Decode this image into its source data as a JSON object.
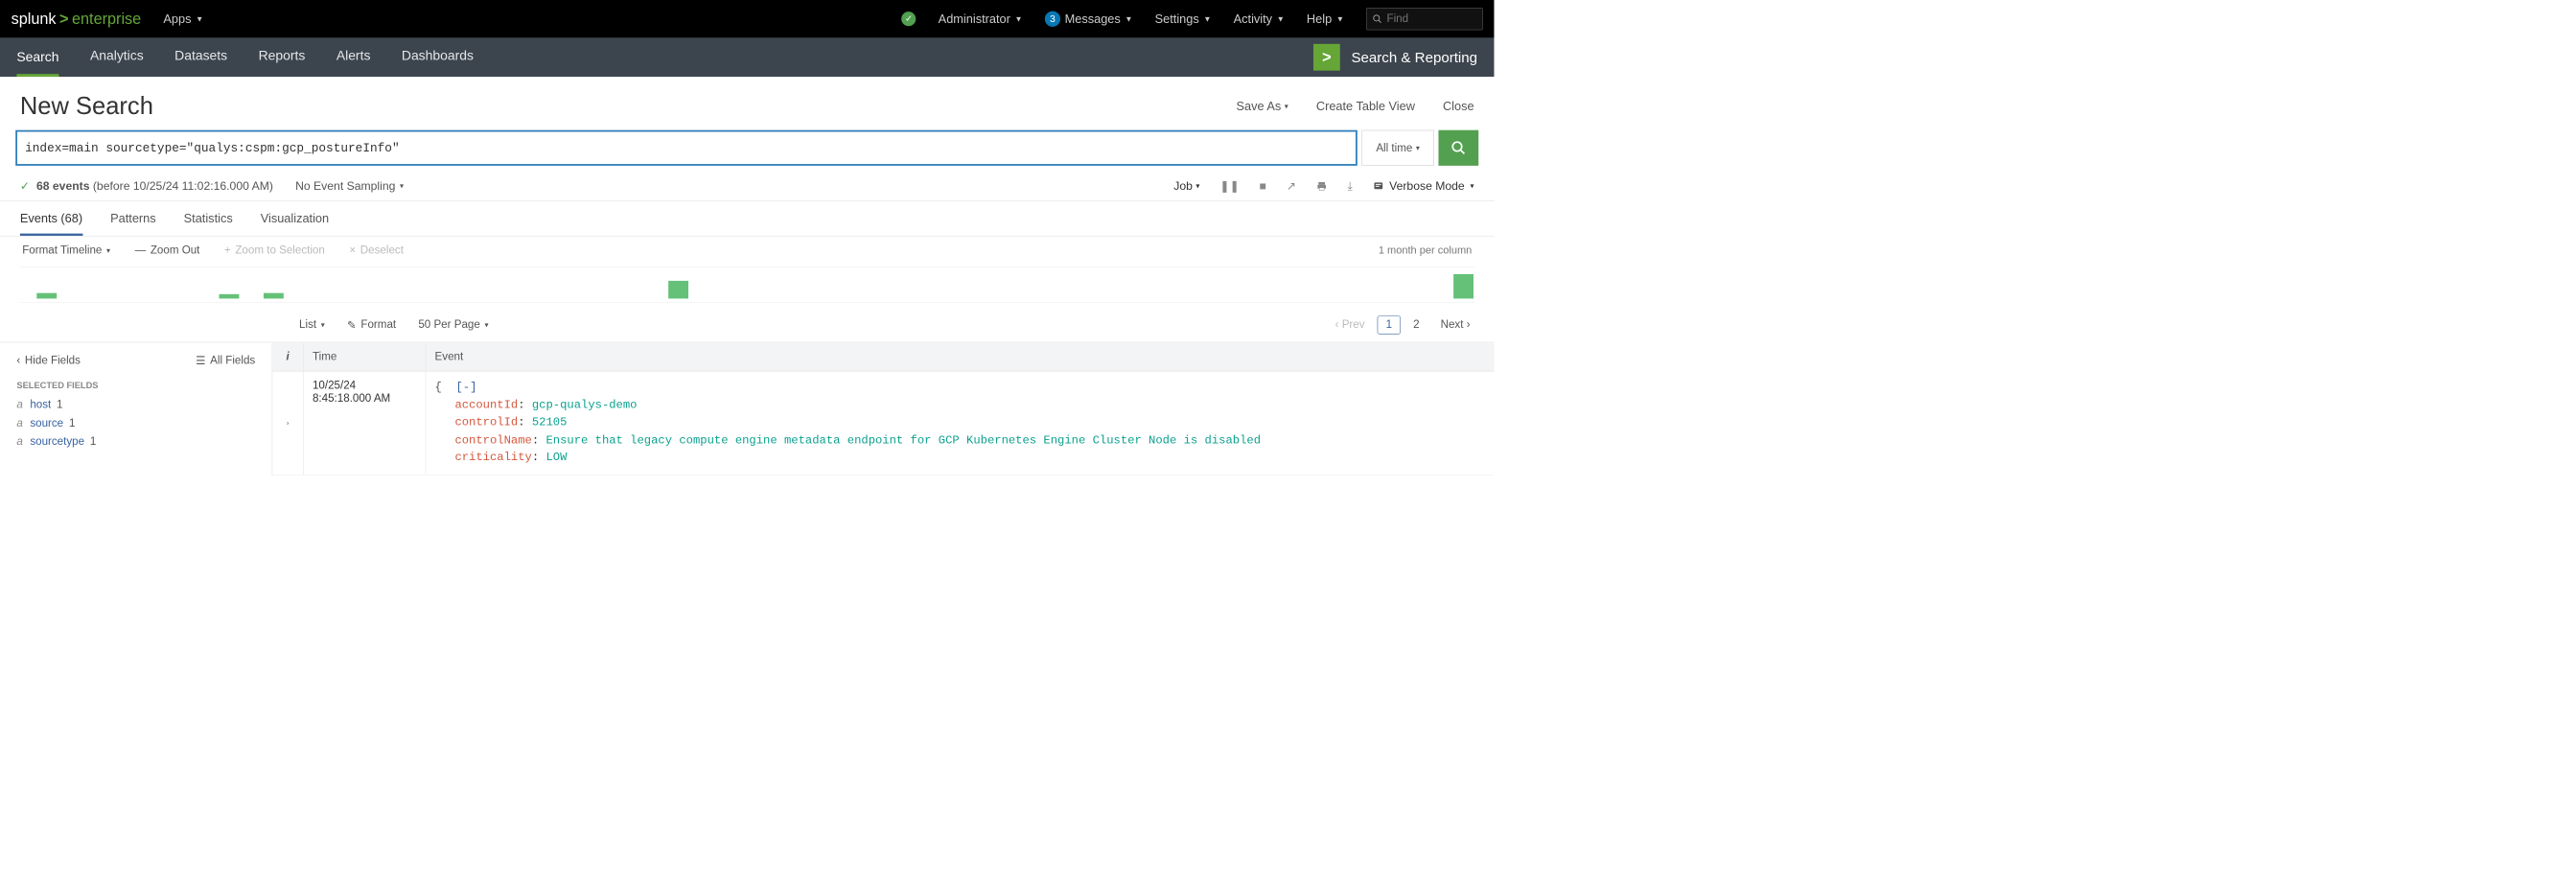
{
  "brand": {
    "pre": "splunk",
    "post": "enterprise"
  },
  "topbar": {
    "apps": "Apps",
    "administrator": "Administrator",
    "messages": "Messages",
    "messages_count": "3",
    "settings": "Settings",
    "activity": "Activity",
    "help": "Help",
    "find_placeholder": "Find"
  },
  "nav": {
    "search": "Search",
    "analytics": "Analytics",
    "datasets": "Datasets",
    "reports": "Reports",
    "alerts": "Alerts",
    "dashboards": "Dashboards",
    "sr_label": "Search & Reporting"
  },
  "page": {
    "title": "New Search",
    "save_as": "Save As",
    "create_table": "Create Table View",
    "close": "Close"
  },
  "search": {
    "query": "index=main sourcetype=\"qualys:cspm:gcp_postureInfo\"",
    "time_label": "All time"
  },
  "summary": {
    "events_count": "68 events",
    "events_note": "(before 10/25/24 11:02:16.000 AM)",
    "sampling": "No Event Sampling",
    "job": "Job",
    "mode": "Verbose Mode"
  },
  "result_tabs": {
    "events": "Events (68)",
    "patterns": "Patterns",
    "statistics": "Statistics",
    "visualization": "Visualization"
  },
  "timeline": {
    "format": "Format Timeline",
    "zoom_out": "Zoom Out",
    "zoom_sel": "Zoom to Selection",
    "deselect": "Deselect",
    "scale": "1 month per column"
  },
  "format_row": {
    "list": "List",
    "format": "Format",
    "per_page": "50 Per Page",
    "prev": "Prev",
    "page1": "1",
    "page2": "2",
    "next": "Next"
  },
  "fields": {
    "hide": "Hide Fields",
    "all": "All Fields",
    "selected_label": "Selected Fields",
    "items": [
      {
        "type": "a",
        "name": "host",
        "count": "1"
      },
      {
        "type": "a",
        "name": "source",
        "count": "1"
      },
      {
        "type": "a",
        "name": "sourcetype",
        "count": "1"
      }
    ]
  },
  "events": {
    "col_i": "i",
    "col_time": "Time",
    "col_event": "Event",
    "row": {
      "date": "10/25/24",
      "time": "8:45:18.000 AM",
      "json": {
        "k_account": "accountId",
        "v_account": "gcp-qualys-demo",
        "k_controlId": "controlId",
        "v_controlId": "52105",
        "k_controlName": "controlName",
        "v_controlName": "Ensure that legacy compute engine metadata endpoint for GCP Kubernetes Engine Cluster Node is disabled",
        "k_criticality": "criticality",
        "v_criticality": "LOW"
      }
    }
  }
}
